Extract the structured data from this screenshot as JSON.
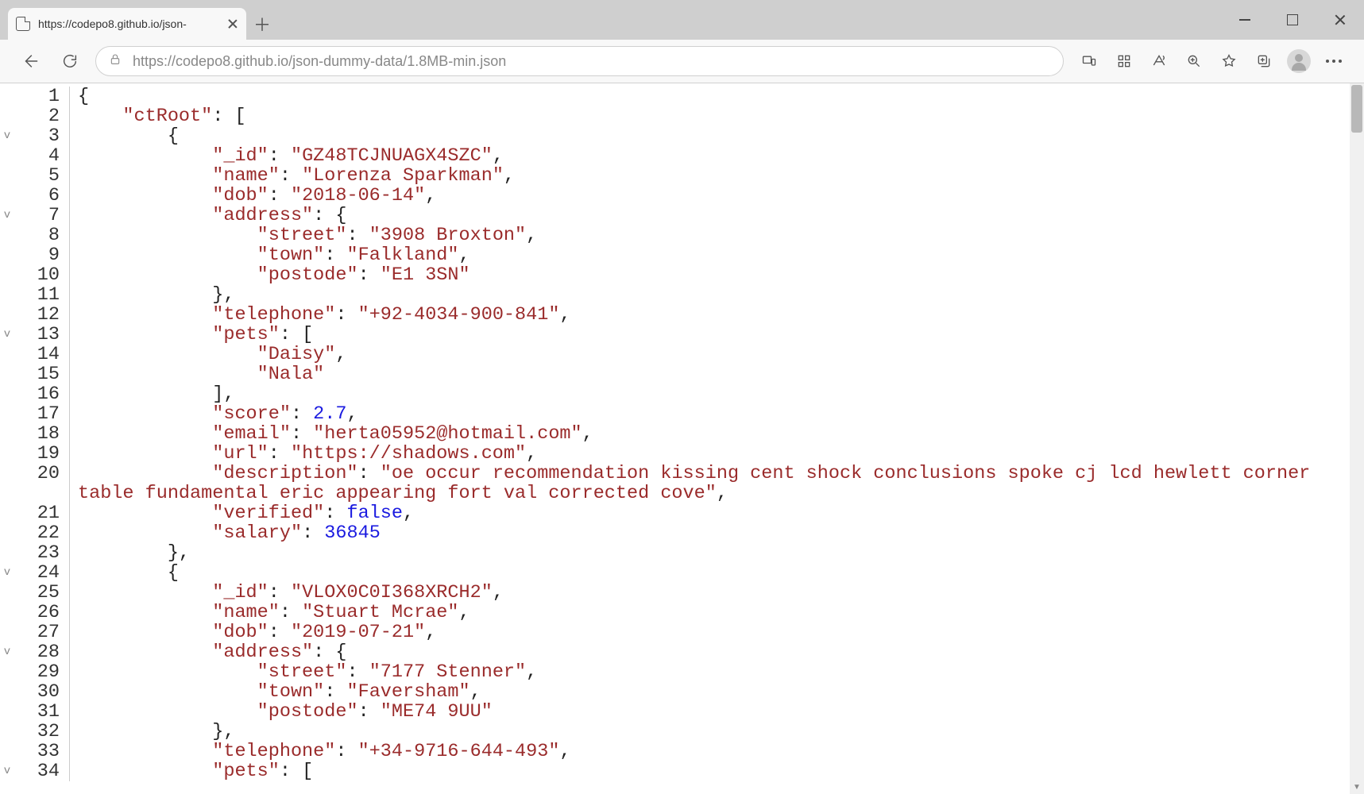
{
  "tab": {
    "title": "https://codepo8.github.io/json-"
  },
  "toolbar": {
    "url": "https://codepo8.github.io/json-dummy-data/1.8MB-min.json"
  },
  "code": {
    "lines": [
      {
        "ln": 1,
        "fold": "",
        "indent": 0,
        "segments": [
          {
            "p": "{"
          }
        ]
      },
      {
        "ln": 2,
        "fold": "",
        "indent": 1,
        "segments": [
          {
            "k": "\"ctRoot\""
          },
          {
            "p": ": ["
          }
        ]
      },
      {
        "ln": 3,
        "fold": "v",
        "indent": 2,
        "segments": [
          {
            "p": "{"
          }
        ]
      },
      {
        "ln": 4,
        "fold": "",
        "indent": 3,
        "segments": [
          {
            "k": "\"_id\""
          },
          {
            "p": ": "
          },
          {
            "s": "\"GZ48TCJNUAGX4SZC\""
          },
          {
            "p": ","
          }
        ]
      },
      {
        "ln": 5,
        "fold": "",
        "indent": 3,
        "segments": [
          {
            "k": "\"name\""
          },
          {
            "p": ": "
          },
          {
            "s": "\"Lorenza Sparkman\""
          },
          {
            "p": ","
          }
        ]
      },
      {
        "ln": 6,
        "fold": "",
        "indent": 3,
        "segments": [
          {
            "k": "\"dob\""
          },
          {
            "p": ": "
          },
          {
            "s": "\"2018-06-14\""
          },
          {
            "p": ","
          }
        ]
      },
      {
        "ln": 7,
        "fold": "v",
        "indent": 3,
        "segments": [
          {
            "k": "\"address\""
          },
          {
            "p": ": {"
          }
        ]
      },
      {
        "ln": 8,
        "fold": "",
        "indent": 4,
        "segments": [
          {
            "k": "\"street\""
          },
          {
            "p": ": "
          },
          {
            "s": "\"3908 Broxton\""
          },
          {
            "p": ","
          }
        ]
      },
      {
        "ln": 9,
        "fold": "",
        "indent": 4,
        "segments": [
          {
            "k": "\"town\""
          },
          {
            "p": ": "
          },
          {
            "s": "\"Falkland\""
          },
          {
            "p": ","
          }
        ]
      },
      {
        "ln": 10,
        "fold": "",
        "indent": 4,
        "segments": [
          {
            "k": "\"postode\""
          },
          {
            "p": ": "
          },
          {
            "s": "\"E1 3SN\""
          }
        ]
      },
      {
        "ln": 11,
        "fold": "",
        "indent": 3,
        "segments": [
          {
            "p": "},"
          }
        ]
      },
      {
        "ln": 12,
        "fold": "",
        "indent": 3,
        "segments": [
          {
            "k": "\"telephone\""
          },
          {
            "p": ": "
          },
          {
            "s": "\"+92-4034-900-841\""
          },
          {
            "p": ","
          }
        ]
      },
      {
        "ln": 13,
        "fold": "v",
        "indent": 3,
        "segments": [
          {
            "k": "\"pets\""
          },
          {
            "p": ": ["
          }
        ]
      },
      {
        "ln": 14,
        "fold": "",
        "indent": 4,
        "segments": [
          {
            "s": "\"Daisy\""
          },
          {
            "p": ","
          }
        ]
      },
      {
        "ln": 15,
        "fold": "",
        "indent": 4,
        "segments": [
          {
            "s": "\"Nala\""
          }
        ]
      },
      {
        "ln": 16,
        "fold": "",
        "indent": 3,
        "segments": [
          {
            "p": "],"
          }
        ]
      },
      {
        "ln": 17,
        "fold": "",
        "indent": 3,
        "segments": [
          {
            "k": "\"score\""
          },
          {
            "p": ": "
          },
          {
            "n": "2.7"
          },
          {
            "p": ","
          }
        ]
      },
      {
        "ln": 18,
        "fold": "",
        "indent": 3,
        "segments": [
          {
            "k": "\"email\""
          },
          {
            "p": ": "
          },
          {
            "s": "\"herta05952@hotmail.com\""
          },
          {
            "p": ","
          }
        ]
      },
      {
        "ln": 19,
        "fold": "",
        "indent": 3,
        "segments": [
          {
            "k": "\"url\""
          },
          {
            "p": ": "
          },
          {
            "s": "\"https://shadows.com\""
          },
          {
            "p": ","
          }
        ]
      },
      {
        "ln": 20,
        "fold": "",
        "indent": 3,
        "wrap": true,
        "segments": [
          {
            "k": "\"description\""
          },
          {
            "p": ": "
          },
          {
            "s": "\"oe occur recommendation kissing cent shock conclusions spoke cj lcd hewlett corner table fundamental eric appearing fort val corrected cove\""
          },
          {
            "p": ","
          }
        ]
      },
      {
        "ln": 21,
        "fold": "",
        "indent": 3,
        "segments": [
          {
            "k": "\"verified\""
          },
          {
            "p": ": "
          },
          {
            "b": "false"
          },
          {
            "p": ","
          }
        ]
      },
      {
        "ln": 22,
        "fold": "",
        "indent": 3,
        "segments": [
          {
            "k": "\"salary\""
          },
          {
            "p": ": "
          },
          {
            "n": "36845"
          }
        ]
      },
      {
        "ln": 23,
        "fold": "",
        "indent": 2,
        "segments": [
          {
            "p": "},"
          }
        ]
      },
      {
        "ln": 24,
        "fold": "v",
        "indent": 2,
        "segments": [
          {
            "p": "{"
          }
        ]
      },
      {
        "ln": 25,
        "fold": "",
        "indent": 3,
        "segments": [
          {
            "k": "\"_id\""
          },
          {
            "p": ": "
          },
          {
            "s": "\"VLOX0C0I368XRCH2\""
          },
          {
            "p": ","
          }
        ]
      },
      {
        "ln": 26,
        "fold": "",
        "indent": 3,
        "segments": [
          {
            "k": "\"name\""
          },
          {
            "p": ": "
          },
          {
            "s": "\"Stuart Mcrae\""
          },
          {
            "p": ","
          }
        ]
      },
      {
        "ln": 27,
        "fold": "",
        "indent": 3,
        "segments": [
          {
            "k": "\"dob\""
          },
          {
            "p": ": "
          },
          {
            "s": "\"2019-07-21\""
          },
          {
            "p": ","
          }
        ]
      },
      {
        "ln": 28,
        "fold": "v",
        "indent": 3,
        "segments": [
          {
            "k": "\"address\""
          },
          {
            "p": ": {"
          }
        ]
      },
      {
        "ln": 29,
        "fold": "",
        "indent": 4,
        "segments": [
          {
            "k": "\"street\""
          },
          {
            "p": ": "
          },
          {
            "s": "\"7177 Stenner\""
          },
          {
            "p": ","
          }
        ]
      },
      {
        "ln": 30,
        "fold": "",
        "indent": 4,
        "segments": [
          {
            "k": "\"town\""
          },
          {
            "p": ": "
          },
          {
            "s": "\"Faversham\""
          },
          {
            "p": ","
          }
        ]
      },
      {
        "ln": 31,
        "fold": "",
        "indent": 4,
        "segments": [
          {
            "k": "\"postode\""
          },
          {
            "p": ": "
          },
          {
            "s": "\"ME74 9UU\""
          }
        ]
      },
      {
        "ln": 32,
        "fold": "",
        "indent": 3,
        "segments": [
          {
            "p": "},"
          }
        ]
      },
      {
        "ln": 33,
        "fold": "",
        "indent": 3,
        "segments": [
          {
            "k": "\"telephone\""
          },
          {
            "p": ": "
          },
          {
            "s": "\"+34-9716-644-493\""
          },
          {
            "p": ","
          }
        ]
      },
      {
        "ln": 34,
        "fold": "v",
        "indent": 3,
        "segments": [
          {
            "k": "\"pets\""
          },
          {
            "p": ": ["
          }
        ]
      }
    ],
    "indent_unit": "    "
  }
}
